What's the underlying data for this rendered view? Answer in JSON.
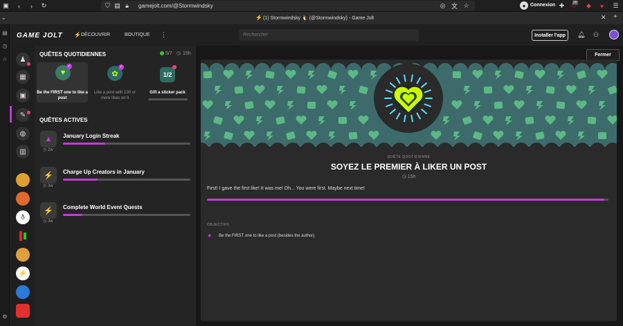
{
  "browser": {
    "url": "gamejolt.com/@Stormwindsky",
    "window_title": "(1) Stormwindsky 🐧 (@Stormwindsky) - Game Jolt",
    "account_label": "Connexion",
    "badge_count": "20"
  },
  "header": {
    "logo": "GAME JOLT",
    "nav_discover": "DÉCOUVRIR",
    "nav_shop": "BOUTIQUE",
    "search_placeholder": "Rechercher",
    "install_label": "Installer l'app"
  },
  "quests": {
    "daily_title": "QUÊTES QUOTIDIENNES",
    "daily_progress": "5/7",
    "daily_time": "15h",
    "daily": [
      {
        "label": "Be the FIRST one to like a post",
        "selected": true
      },
      {
        "label": "Like a post with 100 or more likes on it",
        "selected": false
      },
      {
        "label": "Gift a sticker pack",
        "selected": false
      }
    ],
    "active_title": "QUÊTES ACTIVES",
    "active": [
      {
        "title": "January Login Streak",
        "time": "2w",
        "progress": 0.33
      },
      {
        "title": "Charge Up Creators in January",
        "time": "3w",
        "progress": 0.27
      },
      {
        "title": "Complete World Event Quests",
        "time": "3w",
        "progress": 0.15
      }
    ]
  },
  "modal": {
    "close_label": "Fermer",
    "kicker": "QUÊTE QUOTIDIENNE",
    "title": "SOYEZ LE PREMIER À LIKER UN POST",
    "time": "15h",
    "description": "First! I gave the first like! It was me! Oh... You were first. Maybe next time!",
    "progress": 0.99,
    "objectives_label": "OBJECTIFS",
    "objective": "Be the FIRST one to like a post (besides the author)"
  },
  "colors": {
    "accent": "#c43bd8",
    "lime": "#ccff00",
    "banner": "#3d6b6b",
    "banner_icons": "#5cb885"
  }
}
